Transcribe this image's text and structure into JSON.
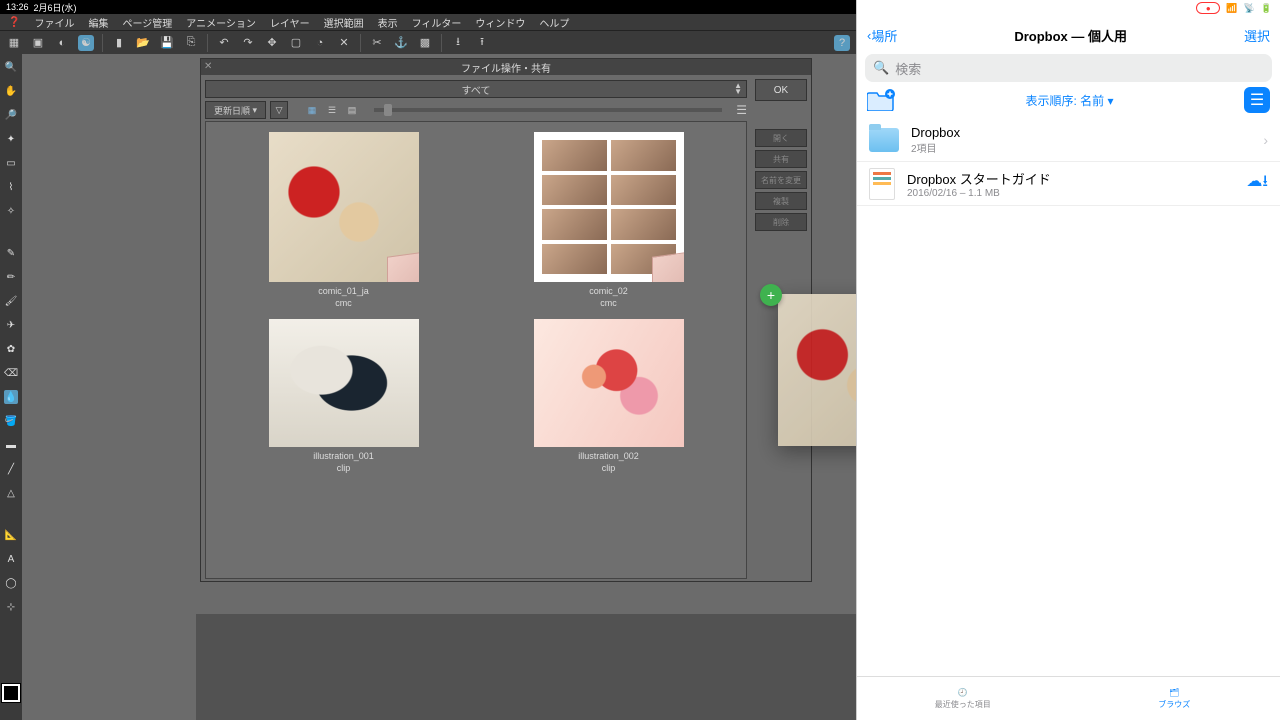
{
  "status": {
    "time": "13:26",
    "date": "2月6日(水)"
  },
  "menu": {
    "items": [
      "ファイル",
      "編集",
      "ページ管理",
      "アニメーション",
      "レイヤー",
      "選択範囲",
      "表示",
      "フィルター",
      "ウィンドウ",
      "ヘルプ"
    ]
  },
  "dialog": {
    "title": "ファイル操作・共有",
    "filter": "すべて",
    "sort": "更新日順",
    "ok": "OK",
    "actions": [
      "開く",
      "共有",
      "名前を変更",
      "複製",
      "削除"
    ],
    "files": [
      {
        "name": "comic_01_ja",
        "ext": "cmc"
      },
      {
        "name": "comic_02",
        "ext": "cmc"
      },
      {
        "name": "illustration_001",
        "ext": "clip"
      },
      {
        "name": "illustration_002",
        "ext": "clip"
      }
    ]
  },
  "dropbox": {
    "back": "場所",
    "title": "Dropbox — 個人用",
    "select": "選択",
    "search_ph": "検索",
    "sort": "表示順序: 名前",
    "rows": [
      {
        "title": "Dropbox",
        "sub": "2項目",
        "type": "folder"
      },
      {
        "title": "Dropbox スタートガイド",
        "sub": "2016/02/16 – 1.1 MB",
        "type": "file"
      }
    ],
    "tabs": {
      "recent": "最近使った項目",
      "browse": "ブラウズ"
    }
  }
}
